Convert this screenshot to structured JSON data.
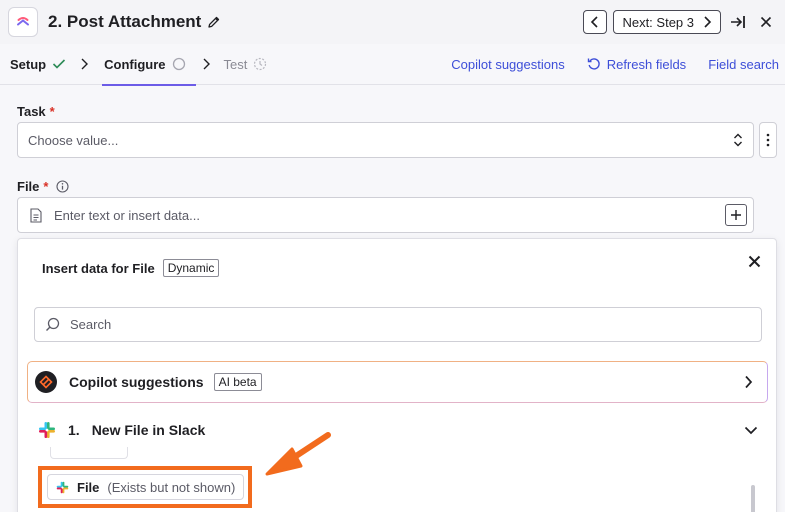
{
  "header": {
    "title": "2. Post Attachment",
    "next_label": "Next: Step 3"
  },
  "tabs": {
    "setup": "Setup",
    "configure": "Configure",
    "test": "Test"
  },
  "links": {
    "copilot": "Copilot suggestions",
    "refresh": "Refresh fields",
    "field_search": "Field search"
  },
  "form": {
    "task_label": "Task",
    "task_placeholder": "Choose value...",
    "file_label": "File",
    "file_placeholder": "Enter text or insert data...",
    "required_mark": "*"
  },
  "panel": {
    "title": "Insert data for File",
    "badge": "Dynamic",
    "search_placeholder": "Search",
    "copilot_title": "Copilot suggestions",
    "copilot_badge": "AI beta",
    "step_number": "1.",
    "step_title": "New File in Slack",
    "chip_label": "File",
    "chip_sub": "(Exists but not shown)"
  },
  "colors": {
    "accent": "#6c5ce7",
    "link": "#3d4ed8",
    "required": "#d93025",
    "highlight": "#f26b1d"
  }
}
